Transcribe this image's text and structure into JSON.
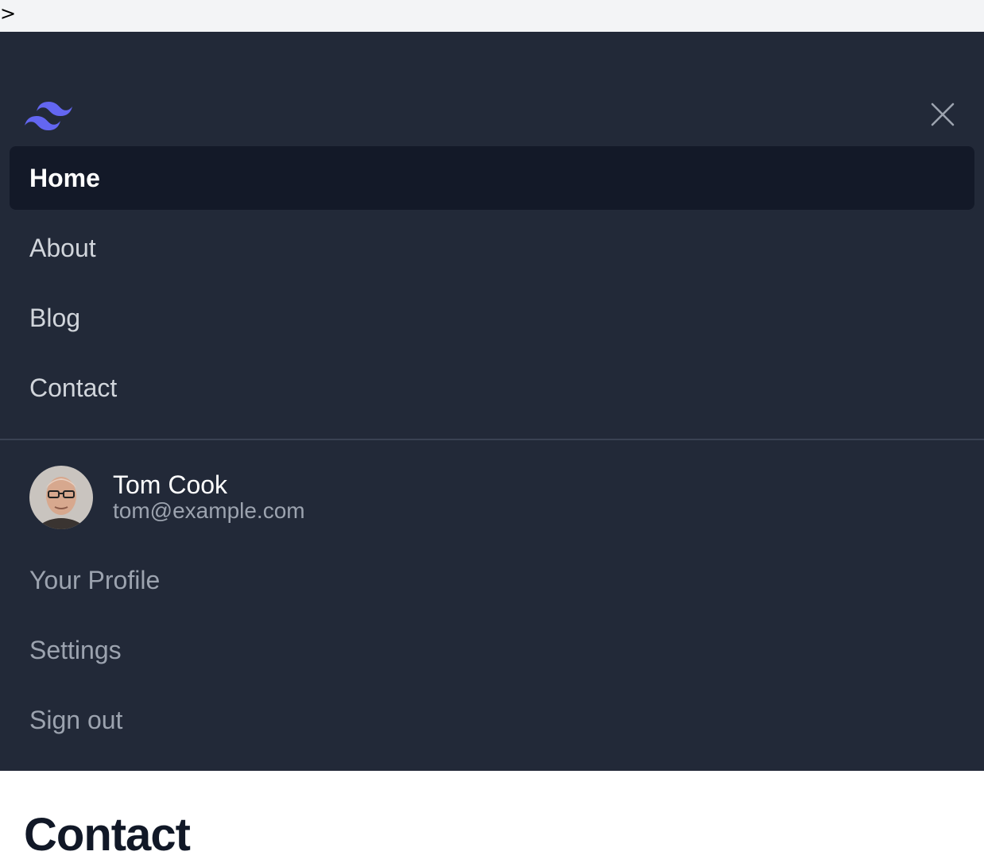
{
  "topbar": {
    "stray_text": ">"
  },
  "brand": {
    "logo_icon": "tailwind-wave-icon",
    "accent": "#6366f1"
  },
  "close": {
    "icon": "close-icon",
    "color": "#9ca3af"
  },
  "nav": {
    "items": [
      {
        "label": "Home",
        "active": true
      },
      {
        "label": "About",
        "active": false
      },
      {
        "label": "Blog",
        "active": false
      },
      {
        "label": "Contact",
        "active": false
      }
    ]
  },
  "user": {
    "name": "Tom Cook",
    "email": "tom@example.com",
    "links": [
      {
        "label": "Your Profile"
      },
      {
        "label": "Settings"
      },
      {
        "label": "Sign out"
      }
    ]
  },
  "page": {
    "heading": "Contact"
  },
  "colors": {
    "menu_bg": "#222938",
    "active_bg": "#131928",
    "topbar_bg": "#f3f4f6"
  }
}
